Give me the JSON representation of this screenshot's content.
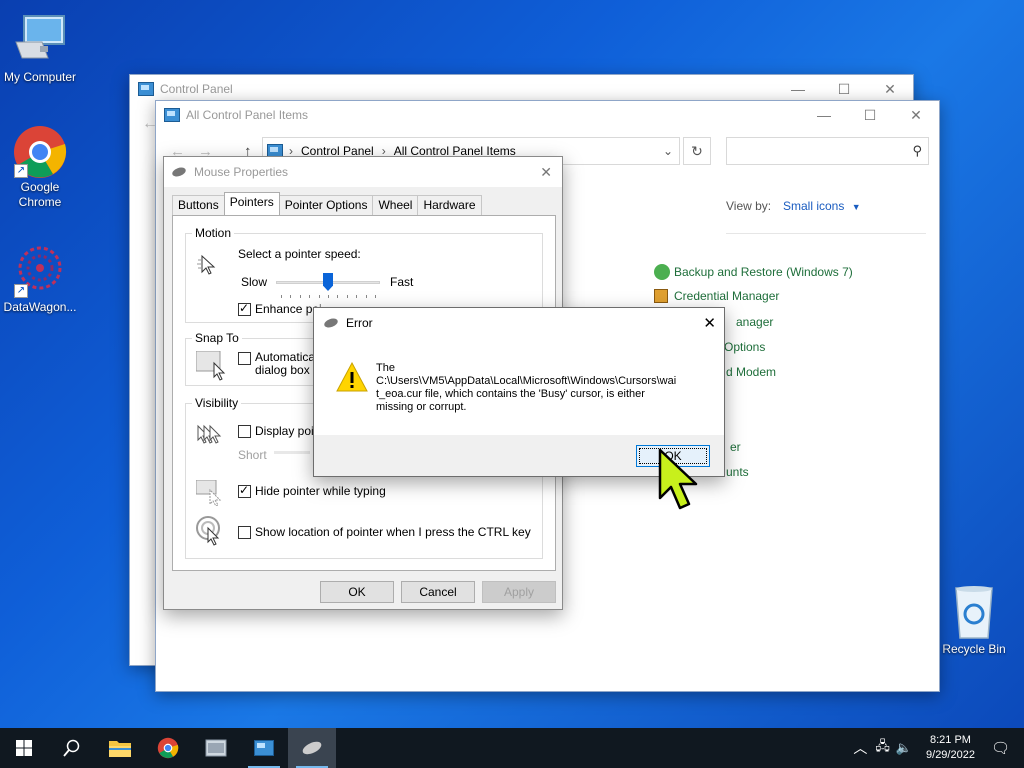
{
  "desktop": {
    "icons": [
      {
        "label": "My Computer",
        "icon": "computer-icon"
      },
      {
        "label": "Google Chrome",
        "icon": "chrome-icon"
      },
      {
        "label": "DataWagon...",
        "icon": "datawagon-icon"
      },
      {
        "label": "Recycle Bin",
        "icon": "recycle-bin-icon"
      }
    ]
  },
  "control_panel": {
    "title": "Control Panel"
  },
  "all_items": {
    "title": "All Control Panel Items",
    "breadcrumb": [
      "Control Panel",
      "All Control Panel Items"
    ],
    "view_by_label": "View by:",
    "view_by_value": "Small icons",
    "items": [
      "Backup and Restore (Windows 7)",
      "Credential Manager",
      "anager",
      "Options",
      "d Modem",
      "er",
      "unts"
    ]
  },
  "mouse_properties": {
    "title": "Mouse Properties",
    "tabs": [
      "Buttons",
      "Pointers",
      "Pointer Options",
      "Wheel",
      "Hardware"
    ],
    "active_tab": "Pointers",
    "motion": {
      "group": "Motion",
      "speed_label": "Select a pointer speed:",
      "slow": "Slow",
      "fast": "Fast",
      "speed_fraction": 0.5,
      "enhance_label": "Enhance poi",
      "enhance_checked": true
    },
    "snap": {
      "group": "Snap To",
      "label1": "Automatically",
      "label2": "dialog box",
      "checked": false
    },
    "visibility": {
      "group": "Visibility",
      "trails_label": "Display point",
      "trails_checked": false,
      "short": "Short",
      "hide_label": "Hide pointer while typing",
      "hide_checked": true,
      "ctrl_label": "Show location of pointer when I press the CTRL key",
      "ctrl_checked": false
    },
    "buttons": {
      "ok": "OK",
      "cancel": "Cancel",
      "apply": "Apply"
    }
  },
  "error": {
    "title": "Error",
    "message_line1": "The",
    "message_line2": "C:\\Users\\VM5\\AppData\\Local\\Microsoft\\Windows\\Cursors\\wai",
    "message_line3": "t_eoa.cur file, which contains the 'Busy' cursor, is either",
    "message_line4": "missing or corrupt.",
    "ok": "OK"
  },
  "taskbar": {
    "time": "8:21 PM",
    "date": "9/29/2022"
  }
}
